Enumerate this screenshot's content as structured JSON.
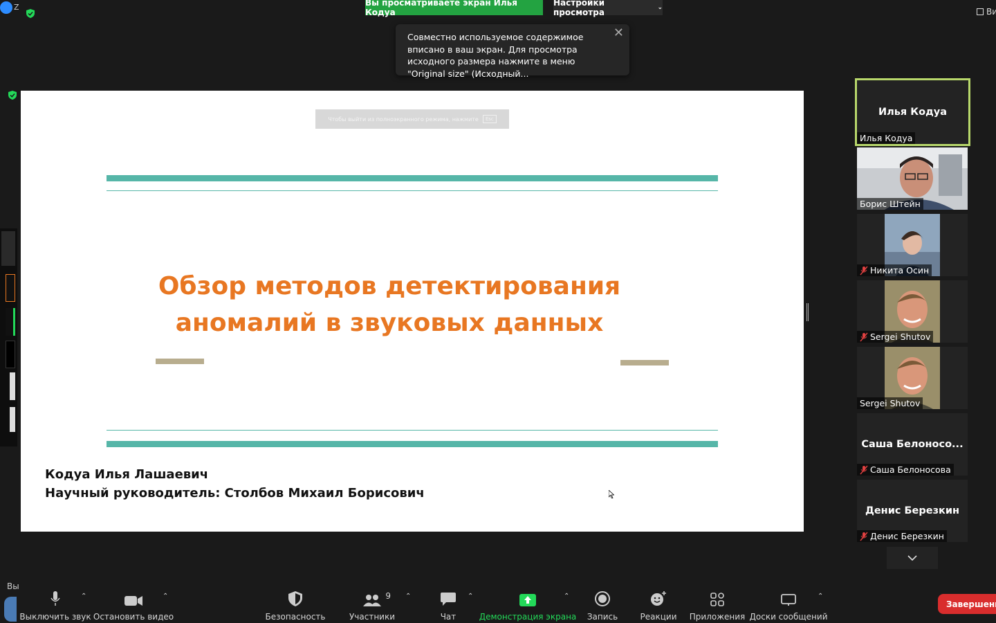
{
  "top": {
    "viewing_banner": "Вы просматриваете экран Илья Кодуа",
    "view_options": "Настройки просмотра",
    "tooltip_text": "Совместно используемое содержимое вписано в ваш экран. Для просмотра исходного размера нажмите в меню \"Original size\" (Исходный...",
    "corner_right": "Ви",
    "corner_left": "Z"
  },
  "slide": {
    "esc_hint": "Чтобы выйти из полноэкранного режима, нажмите",
    "esc_key": "Esc",
    "title_line1": "Обзор методов детектирования",
    "title_line2": "аномалий в звуковых данных",
    "author_line1": "Кодуа Илья Лашаевич",
    "author_line2": "Научный руководитель: Столбов Михаил Борисович",
    "colors": {
      "title": "#e87722",
      "teal": "#56b6a8",
      "taupe": "#b8ad8e"
    }
  },
  "participants": [
    {
      "center_name": "Илья Кодуа",
      "label": "Илья Кодуа",
      "muted": false,
      "active": true,
      "video": false
    },
    {
      "center_name": "",
      "label": "Борис Штейн",
      "muted": false,
      "active": false,
      "video": true
    },
    {
      "center_name": "",
      "label": "Никита Осин",
      "muted": true,
      "active": false,
      "video": true
    },
    {
      "center_name": "",
      "label": "Sergei Shutov",
      "muted": true,
      "active": false,
      "video": true
    },
    {
      "center_name": "",
      "label": "Sergei Shutov",
      "muted": false,
      "active": false,
      "video": true
    },
    {
      "center_name": "Саша  Белоносо...",
      "label": "Саша Белоносова",
      "muted": true,
      "active": false,
      "video": false
    },
    {
      "center_name": "Денис Березкин",
      "label": "Денис Березкин",
      "muted": true,
      "active": false,
      "video": false
    }
  ],
  "toolbar": {
    "mute": "Выключить звук",
    "video": "Остановить видео",
    "security": "Безопасность",
    "participants": "Участники",
    "participants_count": "9",
    "chat": "Чат",
    "share": "Демонстрация экрана",
    "record": "Запись",
    "reactions": "Реакции",
    "apps": "Приложения",
    "whiteboards": "Доски сообщений",
    "end": "Завершение",
    "left_cut": "Вы"
  }
}
